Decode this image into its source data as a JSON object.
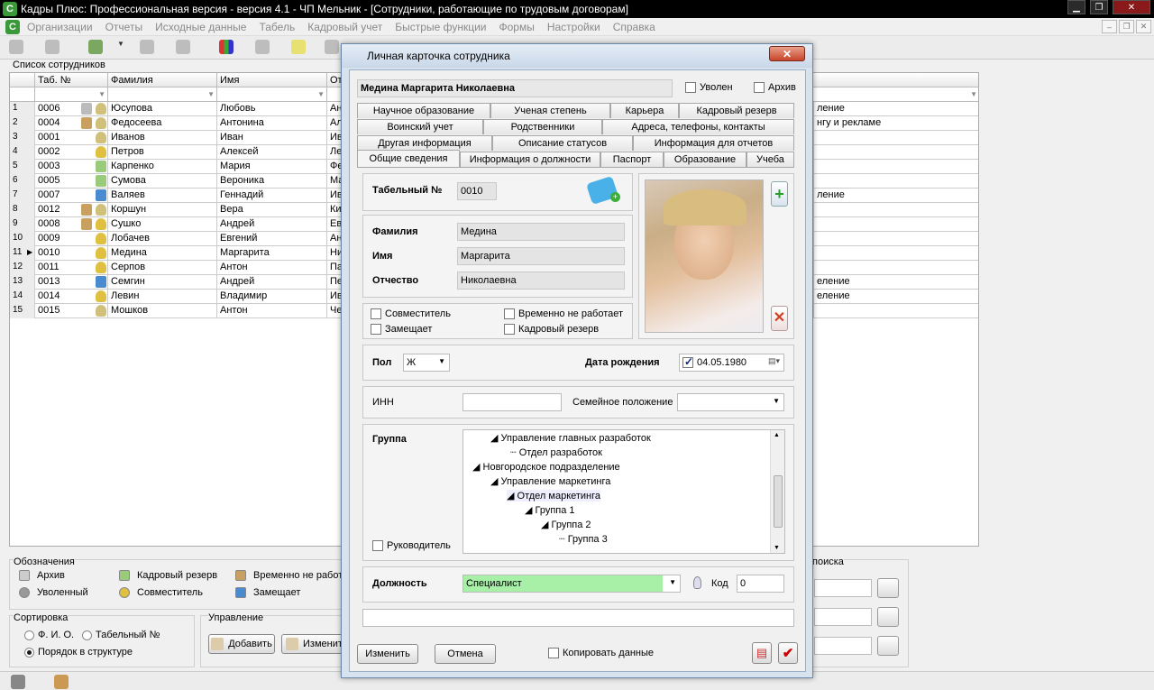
{
  "window": {
    "title": "Кадры Плюс: Профессиональная версия - версия 4.1 - ЧП Мельник - [Сотрудники, работающие по трудовым договорам]",
    "app_icon": "С",
    "min": "▁",
    "max": "❐",
    "close": "✕"
  },
  "menu": [
    "Организации",
    "Отчеты",
    "Исходные данные",
    "Табель",
    "Кадровый учет",
    "Быстрые функции",
    "Формы",
    "Настройки",
    "Справка"
  ],
  "mdi_buttons": {
    "min": "‒",
    "restore": "❐",
    "close": "✕"
  },
  "list": {
    "label": "Список сотрудников",
    "columns": [
      "Таб. №",
      "Фамилия",
      "Имя",
      "От"
    ],
    "rows": [
      {
        "n": "1",
        "tab": "0006",
        "last": "Юсупова",
        "first": "Любовь",
        "mid": "Ан",
        "right": "ление",
        "icons": [
          "archive",
          "person"
        ]
      },
      {
        "n": "2",
        "tab": "0004",
        "last": "Федосеева",
        "first": "Антонина",
        "mid": "Ал",
        "right": "нгу и рекламе",
        "icons": [
          "hourglass",
          "person"
        ]
      },
      {
        "n": "3",
        "tab": "0001",
        "last": "Иванов",
        "first": "Иван",
        "mid": "Ив",
        "right": "",
        "icons": [
          "person"
        ]
      },
      {
        "n": "4",
        "tab": "0002",
        "last": "Петров",
        "first": "Алексей",
        "mid": "Ле",
        "right": "",
        "icons": [
          "group"
        ]
      },
      {
        "n": "5",
        "tab": "0003",
        "last": "Карпенко",
        "first": "Мария",
        "mid": "Фе",
        "right": "",
        "icons": [
          "reserve"
        ]
      },
      {
        "n": "6",
        "tab": "0005",
        "last": "Сумова",
        "first": "Вероника",
        "mid": "Ма",
        "right": "",
        "icons": [
          "reserve"
        ]
      },
      {
        "n": "7",
        "tab": "0007",
        "last": "Валяев",
        "first": "Геннадий",
        "mid": "Ив",
        "right": "ление",
        "icons": [
          "arrow"
        ]
      },
      {
        "n": "8",
        "tab": "0012",
        "last": "Коршун",
        "first": "Вера",
        "mid": "Ки",
        "right": "",
        "icons": [
          "hourglass",
          "person"
        ]
      },
      {
        "n": "9",
        "tab": "0008",
        "last": "Сушко",
        "first": "Андрей",
        "mid": "Ев",
        "right": "",
        "icons": [
          "hourglass",
          "group"
        ]
      },
      {
        "n": "10",
        "tab": "0009",
        "last": "Лобачев",
        "first": "Евгений",
        "mid": "Ан",
        "right": "",
        "icons": [
          "group"
        ]
      },
      {
        "n": "11",
        "tab": "0010",
        "last": "Медина",
        "first": "Маргарита",
        "mid": "Ни",
        "right": "",
        "icons": [
          "group"
        ]
      },
      {
        "n": "12",
        "tab": "0011",
        "last": "Серпов",
        "first": "Антон",
        "mid": "Па",
        "right": "",
        "icons": [
          "group"
        ]
      },
      {
        "n": "13",
        "tab": "0013",
        "last": "Семгин",
        "first": "Андрей",
        "mid": "Пе",
        "right": "еление",
        "icons": [
          "arrow"
        ]
      },
      {
        "n": "14",
        "tab": "0014",
        "last": "Левин",
        "first": "Владимир",
        "mid": "Ив",
        "right": "еление",
        "icons": [
          "group"
        ]
      },
      {
        "n": "15",
        "tab": "0015",
        "last": "Мошков",
        "first": "Антон",
        "mid": "Че",
        "right": "",
        "icons": [
          "person"
        ]
      }
    ]
  },
  "legend": {
    "title": "Обозначения",
    "items": [
      "Архив",
      "Кадровый резерв",
      "Временно не работ",
      "Уволенный",
      "Совместитель",
      "Замещает"
    ]
  },
  "sort": {
    "title": "Сортировка",
    "options": [
      "Ф. И. О.",
      "Табельный №",
      "Порядок в структуре"
    ],
    "selected": 2
  },
  "manage": {
    "title": "Управление",
    "add": "Добавить",
    "edit": "Изменит"
  },
  "search": {
    "title": "поиска"
  },
  "dialog": {
    "title": "Личная карточка сотрудника",
    "close": "✕",
    "full_name": "Медина Маргарита Николаевна",
    "fired_label": "Уволен",
    "archive_label": "Архив",
    "tabs_row1": [
      "Научное образование",
      "Ученая степень",
      "Карьера",
      "Кадровый резерв"
    ],
    "tabs_row2": [
      "Воинский учет",
      "Родственники",
      "Адреса, телефоны, контакты"
    ],
    "tabs_row3": [
      "Другая информация",
      "Описание статусов",
      "Информация для отчетов"
    ],
    "tabs_row4": [
      "Общие сведения",
      "Информация о должности",
      "Паспорт",
      "Образование",
      "Учеба"
    ],
    "tab_number_label": "Табельный №",
    "tab_number": "0010",
    "surname_label": "Фамилия",
    "surname": "Медина",
    "name_label": "Имя",
    "name": "Маргарита",
    "patronymic_label": "Отчество",
    "patronymic": "Николаевна",
    "checks": [
      "Совместитель",
      "Временно не работает",
      "Замещает",
      "Кадровый резерв"
    ],
    "gender_label": "Пол",
    "gender": "Ж",
    "birth_label": "Дата рождения",
    "birth_date": "04.05.1980",
    "inn_label": "ИНН",
    "inn": "",
    "family_label": "Семейное положение",
    "family": "",
    "group_label": "Группа",
    "tree": [
      "Управление главных разработок",
      "Отдел разработок",
      "Новгородское подразделение",
      "Управление маркетинга",
      "Отдел маркетинга",
      "Группа 1",
      "Группа 2",
      "Группа 3"
    ],
    "head_label": "Руководитель",
    "position_label": "Должность",
    "position": "Специалист",
    "code_label": "Код",
    "code": "0",
    "btn_edit": "Изменить",
    "btn_cancel": "Отмена",
    "copy_label": "Копировать данные"
  }
}
